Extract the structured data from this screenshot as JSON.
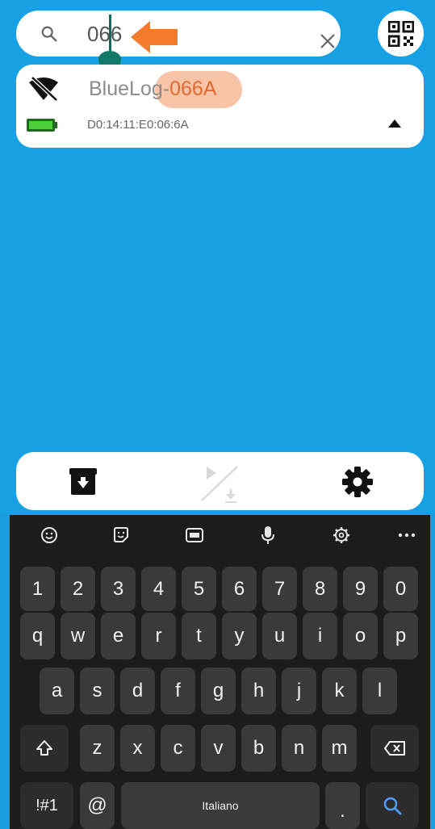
{
  "search": {
    "value": "066",
    "placeholder": ""
  },
  "device": {
    "name_prefix": "BlueLog-",
    "name_highlight": "066A",
    "mac": "D0:14:11:E0:06:6A"
  },
  "colors": {
    "background": "#17a0e3",
    "highlight": "#f8c4a8",
    "arrow": "#f47a2c",
    "caret": "#137a6a",
    "battery": "#4cd137"
  },
  "keyboard": {
    "numbers": [
      "1",
      "2",
      "3",
      "4",
      "5",
      "6",
      "7",
      "8",
      "9",
      "0"
    ],
    "row1": [
      "q",
      "w",
      "e",
      "r",
      "t",
      "y",
      "u",
      "i",
      "o",
      "p"
    ],
    "row2": [
      "a",
      "s",
      "d",
      "f",
      "g",
      "h",
      "j",
      "k",
      "l"
    ],
    "row3": [
      "z",
      "x",
      "c",
      "v",
      "b",
      "n",
      "m"
    ],
    "symbols_label": "!#1",
    "at_label": "@",
    "space_label": "Italiano",
    "period_label": "."
  }
}
